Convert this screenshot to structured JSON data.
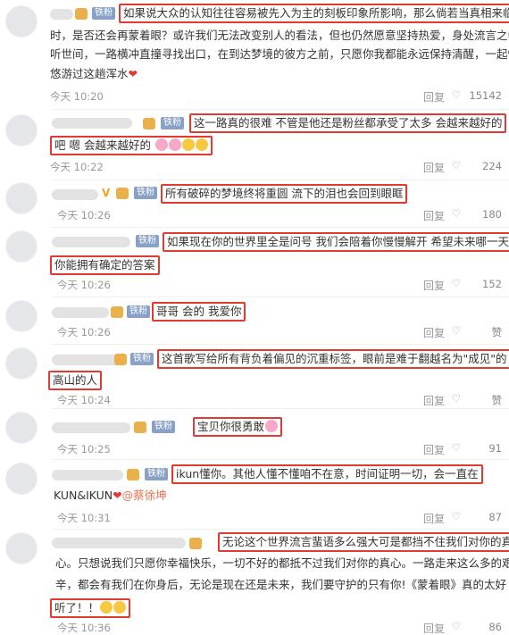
{
  "badge_label": "铁粉",
  "reply_label": "回复",
  "share_char": "⇱",
  "like_char": "♡",
  "comments": [
    {
      "lines": [
        "如果说大众的认知往往容易被先入为主的刻板印象所影响，那么倘若当真相来临",
        "时，是否还会再蒙着眼？或许我们无法改变别人的看法，但也仍然愿意坚持热爱，身处流言之中倾",
        "听世间，一路横冲直撞寻找出口，在到达梦境的彼方之前，只愿你我都能永远保持清醒，一起慢慢",
        "悠游过这趟浑水"
      ],
      "time": "今天 10:20",
      "likes": "15142"
    },
    {
      "lines": [
        "这一路真的很难 不管是他还是粉丝都承受了太多 会越来越好的",
        "吧 嗯 会越来越好的"
      ],
      "time": "今天 10:22",
      "likes": "224"
    },
    {
      "lines": [
        "所有破碎的梦境终将重圆 流下的泪也会回到眼眶"
      ],
      "time": "今天 10:26",
      "likes": "180"
    },
    {
      "lines": [
        "如果现在你的世界里全是问号 我们会陪着你慢慢解开 希望未来哪一天",
        "你能拥有确定的答案"
      ],
      "time": "今天 10:26",
      "likes": "152"
    },
    {
      "lines": [
        "哥哥 会的  我爱你"
      ],
      "time": "今天 10:26",
      "likes": "赞"
    },
    {
      "lines": [
        "这首歌写给所有背负着偏见的沉重标签，眼前是难于翻越名为\"成见\"的",
        "高山的人"
      ],
      "time": "今天 10:24",
      "likes": "赞"
    },
    {
      "lines": [
        "宝贝你很勇敢"
      ],
      "time": "今天 10:25",
      "likes": "91"
    },
    {
      "lines": [
        "ikun懂你。其他人懂不懂咱不在意，时间证明一切，会一直在",
        "KUN&IKUN"
      ],
      "mention": "@蔡徐坤",
      "time": "今天 10:31",
      "likes": "87"
    },
    {
      "lines": [
        "无论这个世界流言蜚语多么强大可是都挡不住我们对你的真",
        "心。只想说我们只愿你幸福快乐，一切不好的都抵不过我们对你的真心。一路走来这么多的艰",
        "辛，都会有我们在你身后，无论是现在还是未来，我们要守护的只有你!《蒙着眼》真的太好",
        "听了！！"
      ],
      "time": "今天 10:36",
      "likes": "86"
    }
  ]
}
